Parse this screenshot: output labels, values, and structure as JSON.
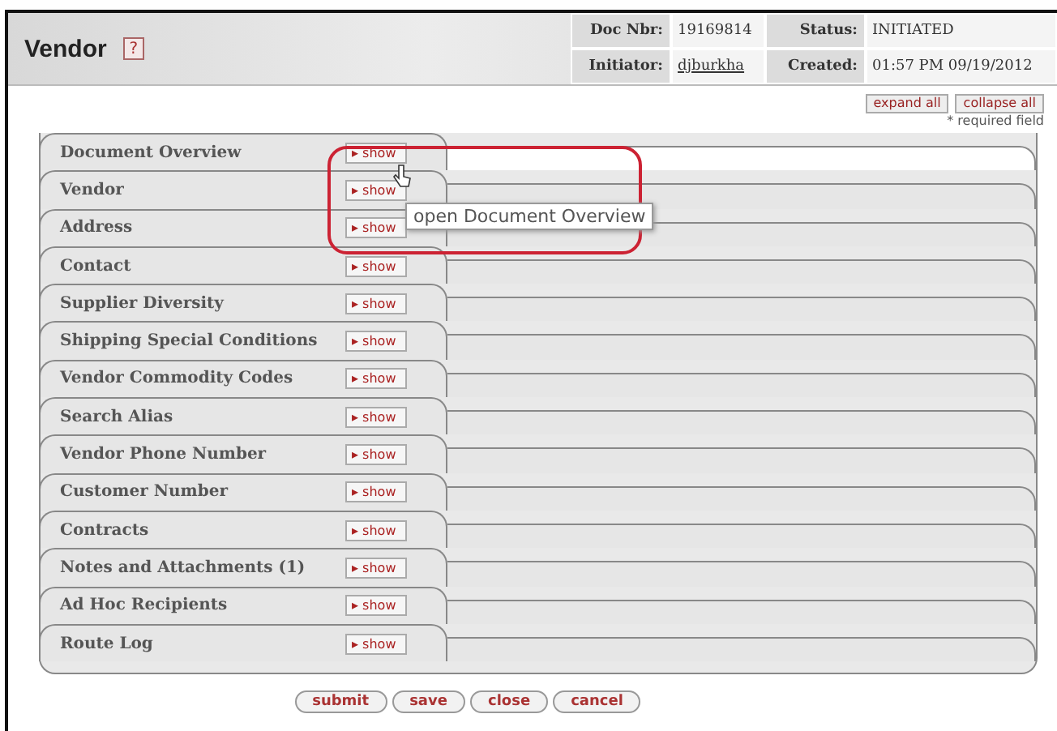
{
  "header": {
    "title": "Vendor",
    "help": "?",
    "fields": [
      {
        "label": "Doc Nbr:",
        "value": "19169814",
        "link": false
      },
      {
        "label": "Status:",
        "value": "INITIATED",
        "link": false
      },
      {
        "label": "Initiator:",
        "value": "djburkha",
        "link": true
      },
      {
        "label": "Created:",
        "value": "01:57 PM 09/19/2012",
        "link": false
      }
    ]
  },
  "toolbar": {
    "buttons": [
      "expand all",
      "collapse all"
    ],
    "note": "* required field"
  },
  "sections": [
    {
      "title": "Document Overview",
      "toggle": "▸ show"
    },
    {
      "title": "Vendor",
      "toggle": "▸ show"
    },
    {
      "title": "Address",
      "toggle": "▸ show"
    },
    {
      "title": "Contact",
      "toggle": "▸ show"
    },
    {
      "title": "Supplier Diversity",
      "toggle": "▸ show"
    },
    {
      "title": "Shipping Special Conditions",
      "toggle": "▸ show"
    },
    {
      "title": "Vendor Commodity Codes",
      "toggle": "▸ show"
    },
    {
      "title": "Search Alias",
      "toggle": "▸ show"
    },
    {
      "title": "Vendor Phone Number",
      "toggle": "▸ show"
    },
    {
      "title": "Customer Number",
      "toggle": "▸ show"
    },
    {
      "title": "Contracts",
      "toggle": "▸ show"
    },
    {
      "title": "Notes and Attachments (1)",
      "toggle": "▸ show"
    },
    {
      "title": "Ad Hoc Recipients",
      "toggle": "▸ show"
    },
    {
      "title": "Route Log",
      "toggle": "▸ show"
    }
  ],
  "tooltip": "open Document Overview",
  "actions": [
    "submit",
    "save",
    "close",
    "cancel"
  ]
}
